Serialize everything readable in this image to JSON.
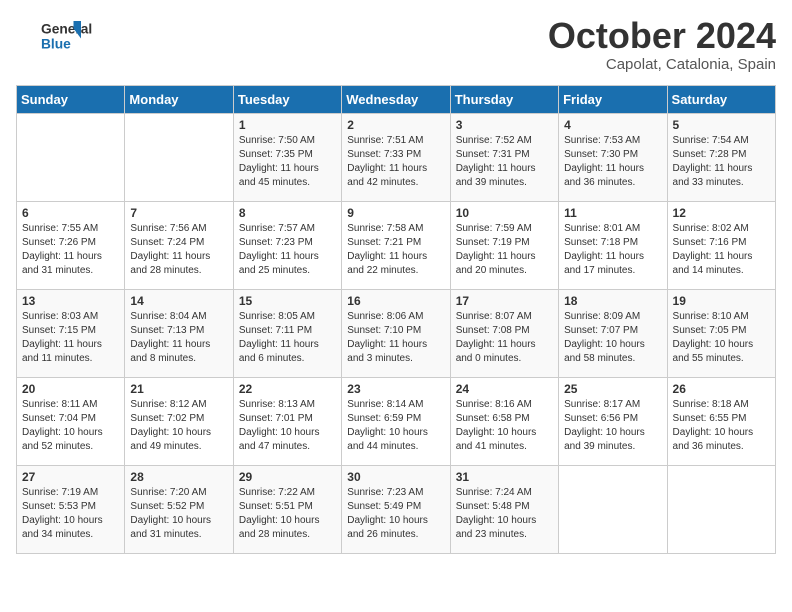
{
  "header": {
    "logo_line1": "General",
    "logo_line2": "Blue",
    "month_title": "October 2024",
    "location": "Capolat, Catalonia, Spain"
  },
  "days_of_week": [
    "Sunday",
    "Monday",
    "Tuesday",
    "Wednesday",
    "Thursday",
    "Friday",
    "Saturday"
  ],
  "weeks": [
    [
      {
        "day": "",
        "sunrise": "",
        "sunset": "",
        "daylight": ""
      },
      {
        "day": "",
        "sunrise": "",
        "sunset": "",
        "daylight": ""
      },
      {
        "day": "1",
        "sunrise": "Sunrise: 7:50 AM",
        "sunset": "Sunset: 7:35 PM",
        "daylight": "Daylight: 11 hours and 45 minutes."
      },
      {
        "day": "2",
        "sunrise": "Sunrise: 7:51 AM",
        "sunset": "Sunset: 7:33 PM",
        "daylight": "Daylight: 11 hours and 42 minutes."
      },
      {
        "day": "3",
        "sunrise": "Sunrise: 7:52 AM",
        "sunset": "Sunset: 7:31 PM",
        "daylight": "Daylight: 11 hours and 39 minutes."
      },
      {
        "day": "4",
        "sunrise": "Sunrise: 7:53 AM",
        "sunset": "Sunset: 7:30 PM",
        "daylight": "Daylight: 11 hours and 36 minutes."
      },
      {
        "day": "5",
        "sunrise": "Sunrise: 7:54 AM",
        "sunset": "Sunset: 7:28 PM",
        "daylight": "Daylight: 11 hours and 33 minutes."
      }
    ],
    [
      {
        "day": "6",
        "sunrise": "Sunrise: 7:55 AM",
        "sunset": "Sunset: 7:26 PM",
        "daylight": "Daylight: 11 hours and 31 minutes."
      },
      {
        "day": "7",
        "sunrise": "Sunrise: 7:56 AM",
        "sunset": "Sunset: 7:24 PM",
        "daylight": "Daylight: 11 hours and 28 minutes."
      },
      {
        "day": "8",
        "sunrise": "Sunrise: 7:57 AM",
        "sunset": "Sunset: 7:23 PM",
        "daylight": "Daylight: 11 hours and 25 minutes."
      },
      {
        "day": "9",
        "sunrise": "Sunrise: 7:58 AM",
        "sunset": "Sunset: 7:21 PM",
        "daylight": "Daylight: 11 hours and 22 minutes."
      },
      {
        "day": "10",
        "sunrise": "Sunrise: 7:59 AM",
        "sunset": "Sunset: 7:19 PM",
        "daylight": "Daylight: 11 hours and 20 minutes."
      },
      {
        "day": "11",
        "sunrise": "Sunrise: 8:01 AM",
        "sunset": "Sunset: 7:18 PM",
        "daylight": "Daylight: 11 hours and 17 minutes."
      },
      {
        "day": "12",
        "sunrise": "Sunrise: 8:02 AM",
        "sunset": "Sunset: 7:16 PM",
        "daylight": "Daylight: 11 hours and 14 minutes."
      }
    ],
    [
      {
        "day": "13",
        "sunrise": "Sunrise: 8:03 AM",
        "sunset": "Sunset: 7:15 PM",
        "daylight": "Daylight: 11 hours and 11 minutes."
      },
      {
        "day": "14",
        "sunrise": "Sunrise: 8:04 AM",
        "sunset": "Sunset: 7:13 PM",
        "daylight": "Daylight: 11 hours and 8 minutes."
      },
      {
        "day": "15",
        "sunrise": "Sunrise: 8:05 AM",
        "sunset": "Sunset: 7:11 PM",
        "daylight": "Daylight: 11 hours and 6 minutes."
      },
      {
        "day": "16",
        "sunrise": "Sunrise: 8:06 AM",
        "sunset": "Sunset: 7:10 PM",
        "daylight": "Daylight: 11 hours and 3 minutes."
      },
      {
        "day": "17",
        "sunrise": "Sunrise: 8:07 AM",
        "sunset": "Sunset: 7:08 PM",
        "daylight": "Daylight: 11 hours and 0 minutes."
      },
      {
        "day": "18",
        "sunrise": "Sunrise: 8:09 AM",
        "sunset": "Sunset: 7:07 PM",
        "daylight": "Daylight: 10 hours and 58 minutes."
      },
      {
        "day": "19",
        "sunrise": "Sunrise: 8:10 AM",
        "sunset": "Sunset: 7:05 PM",
        "daylight": "Daylight: 10 hours and 55 minutes."
      }
    ],
    [
      {
        "day": "20",
        "sunrise": "Sunrise: 8:11 AM",
        "sunset": "Sunset: 7:04 PM",
        "daylight": "Daylight: 10 hours and 52 minutes."
      },
      {
        "day": "21",
        "sunrise": "Sunrise: 8:12 AM",
        "sunset": "Sunset: 7:02 PM",
        "daylight": "Daylight: 10 hours and 49 minutes."
      },
      {
        "day": "22",
        "sunrise": "Sunrise: 8:13 AM",
        "sunset": "Sunset: 7:01 PM",
        "daylight": "Daylight: 10 hours and 47 minutes."
      },
      {
        "day": "23",
        "sunrise": "Sunrise: 8:14 AM",
        "sunset": "Sunset: 6:59 PM",
        "daylight": "Daylight: 10 hours and 44 minutes."
      },
      {
        "day": "24",
        "sunrise": "Sunrise: 8:16 AM",
        "sunset": "Sunset: 6:58 PM",
        "daylight": "Daylight: 10 hours and 41 minutes."
      },
      {
        "day": "25",
        "sunrise": "Sunrise: 8:17 AM",
        "sunset": "Sunset: 6:56 PM",
        "daylight": "Daylight: 10 hours and 39 minutes."
      },
      {
        "day": "26",
        "sunrise": "Sunrise: 8:18 AM",
        "sunset": "Sunset: 6:55 PM",
        "daylight": "Daylight: 10 hours and 36 minutes."
      }
    ],
    [
      {
        "day": "27",
        "sunrise": "Sunrise: 7:19 AM",
        "sunset": "Sunset: 5:53 PM",
        "daylight": "Daylight: 10 hours and 34 minutes."
      },
      {
        "day": "28",
        "sunrise": "Sunrise: 7:20 AM",
        "sunset": "Sunset: 5:52 PM",
        "daylight": "Daylight: 10 hours and 31 minutes."
      },
      {
        "day": "29",
        "sunrise": "Sunrise: 7:22 AM",
        "sunset": "Sunset: 5:51 PM",
        "daylight": "Daylight: 10 hours and 28 minutes."
      },
      {
        "day": "30",
        "sunrise": "Sunrise: 7:23 AM",
        "sunset": "Sunset: 5:49 PM",
        "daylight": "Daylight: 10 hours and 26 minutes."
      },
      {
        "day": "31",
        "sunrise": "Sunrise: 7:24 AM",
        "sunset": "Sunset: 5:48 PM",
        "daylight": "Daylight: 10 hours and 23 minutes."
      },
      {
        "day": "",
        "sunrise": "",
        "sunset": "",
        "daylight": ""
      },
      {
        "day": "",
        "sunrise": "",
        "sunset": "",
        "daylight": ""
      }
    ]
  ]
}
